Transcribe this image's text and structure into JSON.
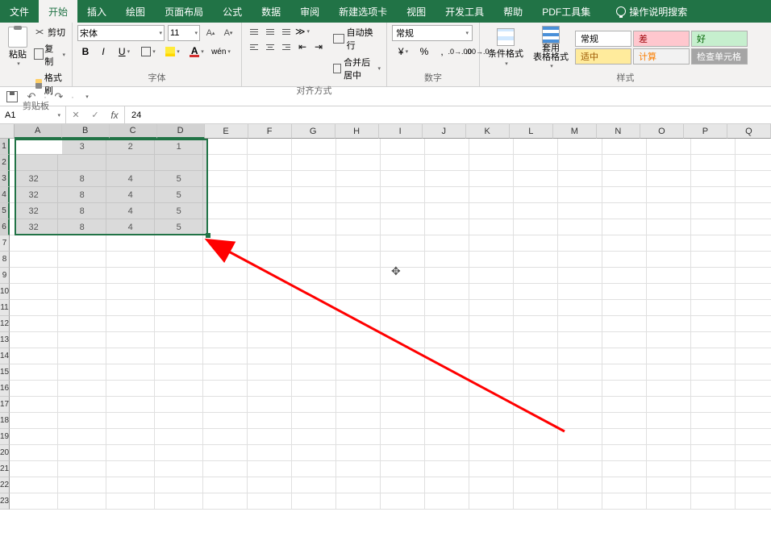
{
  "tabs": {
    "file": "文件",
    "home": "开始",
    "insert": "插入",
    "draw": "绘图",
    "page_layout": "页面布局",
    "formulas": "公式",
    "data": "数据",
    "review": "审阅",
    "new_tab": "新建选项卡",
    "view": "视图",
    "developer": "开发工具",
    "help": "帮助",
    "pdf": "PDF工具集",
    "search": "操作说明搜索"
  },
  "ribbon": {
    "clipboard": {
      "label": "剪贴板",
      "paste": "粘贴",
      "cut": "剪切",
      "copy": "复制",
      "format_painter": "格式刷"
    },
    "font": {
      "label": "字体",
      "name": "宋体",
      "size": "11",
      "inc_caret": "▾"
    },
    "alignment": {
      "label": "对齐方式",
      "wrap": "自动换行",
      "merge": "合并后居中"
    },
    "number": {
      "label": "数字",
      "general": "常规"
    },
    "styles": {
      "label": "样式",
      "cond_fmt": "条件格式",
      "table_fmt": "套用\n表格格式",
      "normal": "常规",
      "bad": "差",
      "good": "好",
      "neutral": "适中",
      "calc": "计算",
      "check": "检查单元格"
    }
  },
  "name_box": "A1",
  "formula_value": "24",
  "columns": [
    "A",
    "B",
    "C",
    "D",
    "E",
    "F",
    "G",
    "H",
    "I",
    "J",
    "K",
    "L",
    "M",
    "N",
    "O",
    "P",
    "Q"
  ],
  "col_widths": {
    "default": 55,
    "first4": 60
  },
  "row_count": 23,
  "selected_rows": [
    1,
    2,
    3,
    4,
    5,
    6
  ],
  "selected_cols": [
    0,
    1,
    2,
    3
  ],
  "active_cell": {
    "row": 1,
    "col": 0
  },
  "data_rows": [
    {
      "r": 1,
      "vals": [
        "24",
        "3",
        "2",
        "1"
      ]
    },
    {
      "r": 3,
      "vals": [
        "32",
        "8",
        "4",
        "5"
      ]
    },
    {
      "r": 4,
      "vals": [
        "32",
        "8",
        "4",
        "5"
      ]
    },
    {
      "r": 5,
      "vals": [
        "32",
        "8",
        "4",
        "5"
      ]
    },
    {
      "r": 6,
      "vals": [
        "32",
        "8",
        "4",
        "5"
      ]
    }
  ],
  "chart_data": {
    "type": "table",
    "columns": [
      "A",
      "B",
      "C",
      "D"
    ],
    "rows": [
      [
        24,
        3,
        2,
        1
      ],
      [
        null,
        null,
        null,
        null
      ],
      [
        32,
        8,
        4,
        5
      ],
      [
        32,
        8,
        4,
        5
      ],
      [
        32,
        8,
        4,
        5
      ],
      [
        32,
        8,
        4,
        5
      ]
    ]
  }
}
